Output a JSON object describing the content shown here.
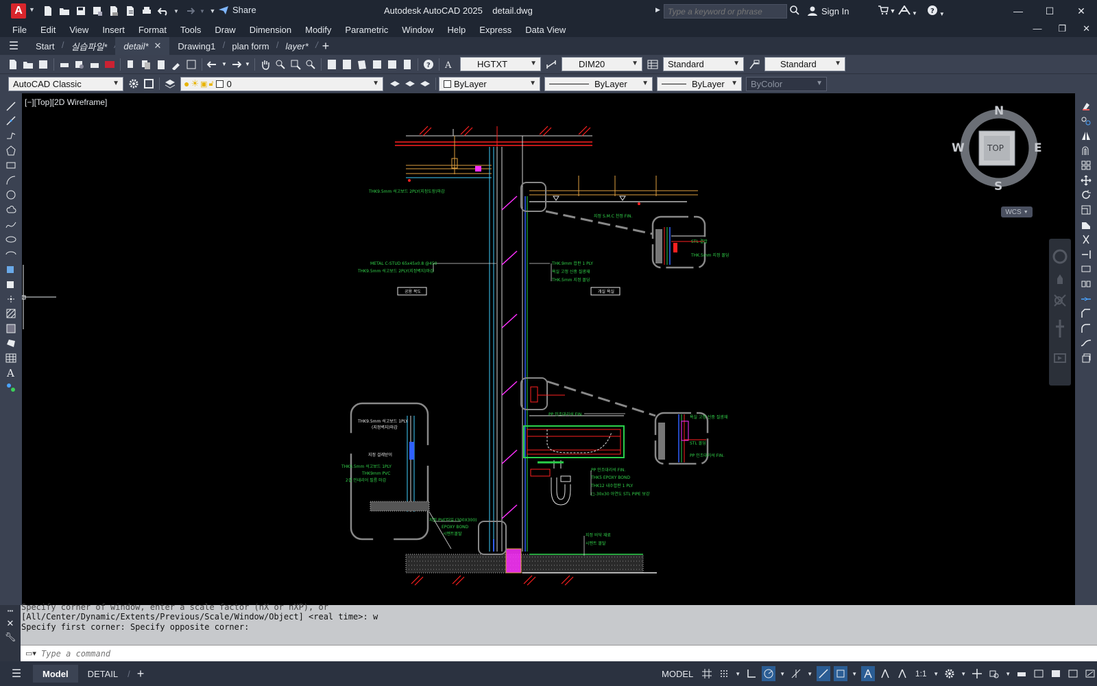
{
  "app": {
    "title": "Autodesk AutoCAD 2025    detail.dwg",
    "logo_letter": "A",
    "share_label": "Share",
    "search_placeholder": "Type a keyword or phrase",
    "signin_label": "Sign In"
  },
  "menu": [
    "File",
    "Edit",
    "View",
    "Insert",
    "Format",
    "Tools",
    "Draw",
    "Dimension",
    "Modify",
    "Parametric",
    "Window",
    "Help",
    "Express",
    "Data View"
  ],
  "file_tabs": [
    {
      "label": "Start",
      "active": false
    },
    {
      "label": "실습파일*",
      "active": false
    },
    {
      "label": "detail*",
      "active": true
    },
    {
      "label": "Drawing1",
      "active": false
    },
    {
      "label": "plan form",
      "active": false
    },
    {
      "label": "layer*",
      "active": false
    }
  ],
  "toolbar": {
    "text_style": "HGTXT",
    "dim_style": "DIM20",
    "table_style": "Standard",
    "mleader_style": "Standard",
    "workspace": "AutoCAD Classic",
    "layer": "0",
    "color": "ByLayer",
    "linetype": "ByLayer",
    "lineweight": "ByLayer",
    "plot_style": "ByColor"
  },
  "viewport": {
    "label": "[−][Top][2D Wireframe]",
    "viewcube": {
      "north": "N",
      "south": "S",
      "east": "E",
      "west": "W",
      "face": "TOP"
    },
    "wcs": "WCS"
  },
  "drawing_text": {
    "room_left": "공용 복도",
    "room_right": "개실 욕실",
    "top_note": "THK9.5mm 석고보드 2PLY(지정도장)마감",
    "ceiling_note": "지정 S.M.C 천정 FIN.",
    "stud_1": "METAL C-STUD 65x45x0.8 @450",
    "stud_2": "THK9.5mm 석고보드 2PLY(지정벽지)마감",
    "wall_1": "THK.9mm 합판 1 PLY",
    "wall_2": "욕실 고정 신중 질광재",
    "wall_3": "THK.5mm 지정 몰딩",
    "det1_1": "STL 결합",
    "det1_2": "THK.5mm 지정 몰딩",
    "vanity_1": "PP 인조대리석 FIN.",
    "det2_1": "욕실 고정 신중 질광재",
    "det2_2": "STL 몰딩",
    "det2_3": "PP 인조대리석 FIN.",
    "sink_1": "PP 인조대리석 FIN.",
    "sink_2": "THK5 EPOXY BOND",
    "sink_3": "THK12 내수합판 1 PLY",
    "sink_4": "□-30x30 아연도 STL PIPE 보강",
    "floor_1": "지정 바닥 재료",
    "floor_2": "시멘트 몰탈",
    "left_det_1": "THK9.5mm 석고보드 1PLY",
    "left_det_2": "(지정벽지)마감",
    "left_det_3": "지정 걸레받이",
    "left_det_4": "THK9.5mm 석고보드 1PLY",
    "left_det_5": "THK9mm PVC",
    "left_det_6": "2겹 인테리어 필름 마감",
    "left_floor_1": "지정 PVC타일 (300X300)",
    "left_floor_2": "EPOXY BOND",
    "left_floor_3": "시멘트몰탈"
  },
  "command": {
    "history": [
      "Specify corner of window, enter a scale factor (nX or nXP), or",
      "[All/Center/Dynamic/Extents/Previous/Scale/Window/Object] <real time>: w",
      "Specify first corner: Specify opposite corner:"
    ],
    "placeholder": "Type a command"
  },
  "layout_tabs": [
    {
      "label": "Model",
      "active": true
    },
    {
      "label": "DETAIL",
      "active": false
    }
  ],
  "status": {
    "space": "MODEL",
    "scale": "1:1"
  }
}
